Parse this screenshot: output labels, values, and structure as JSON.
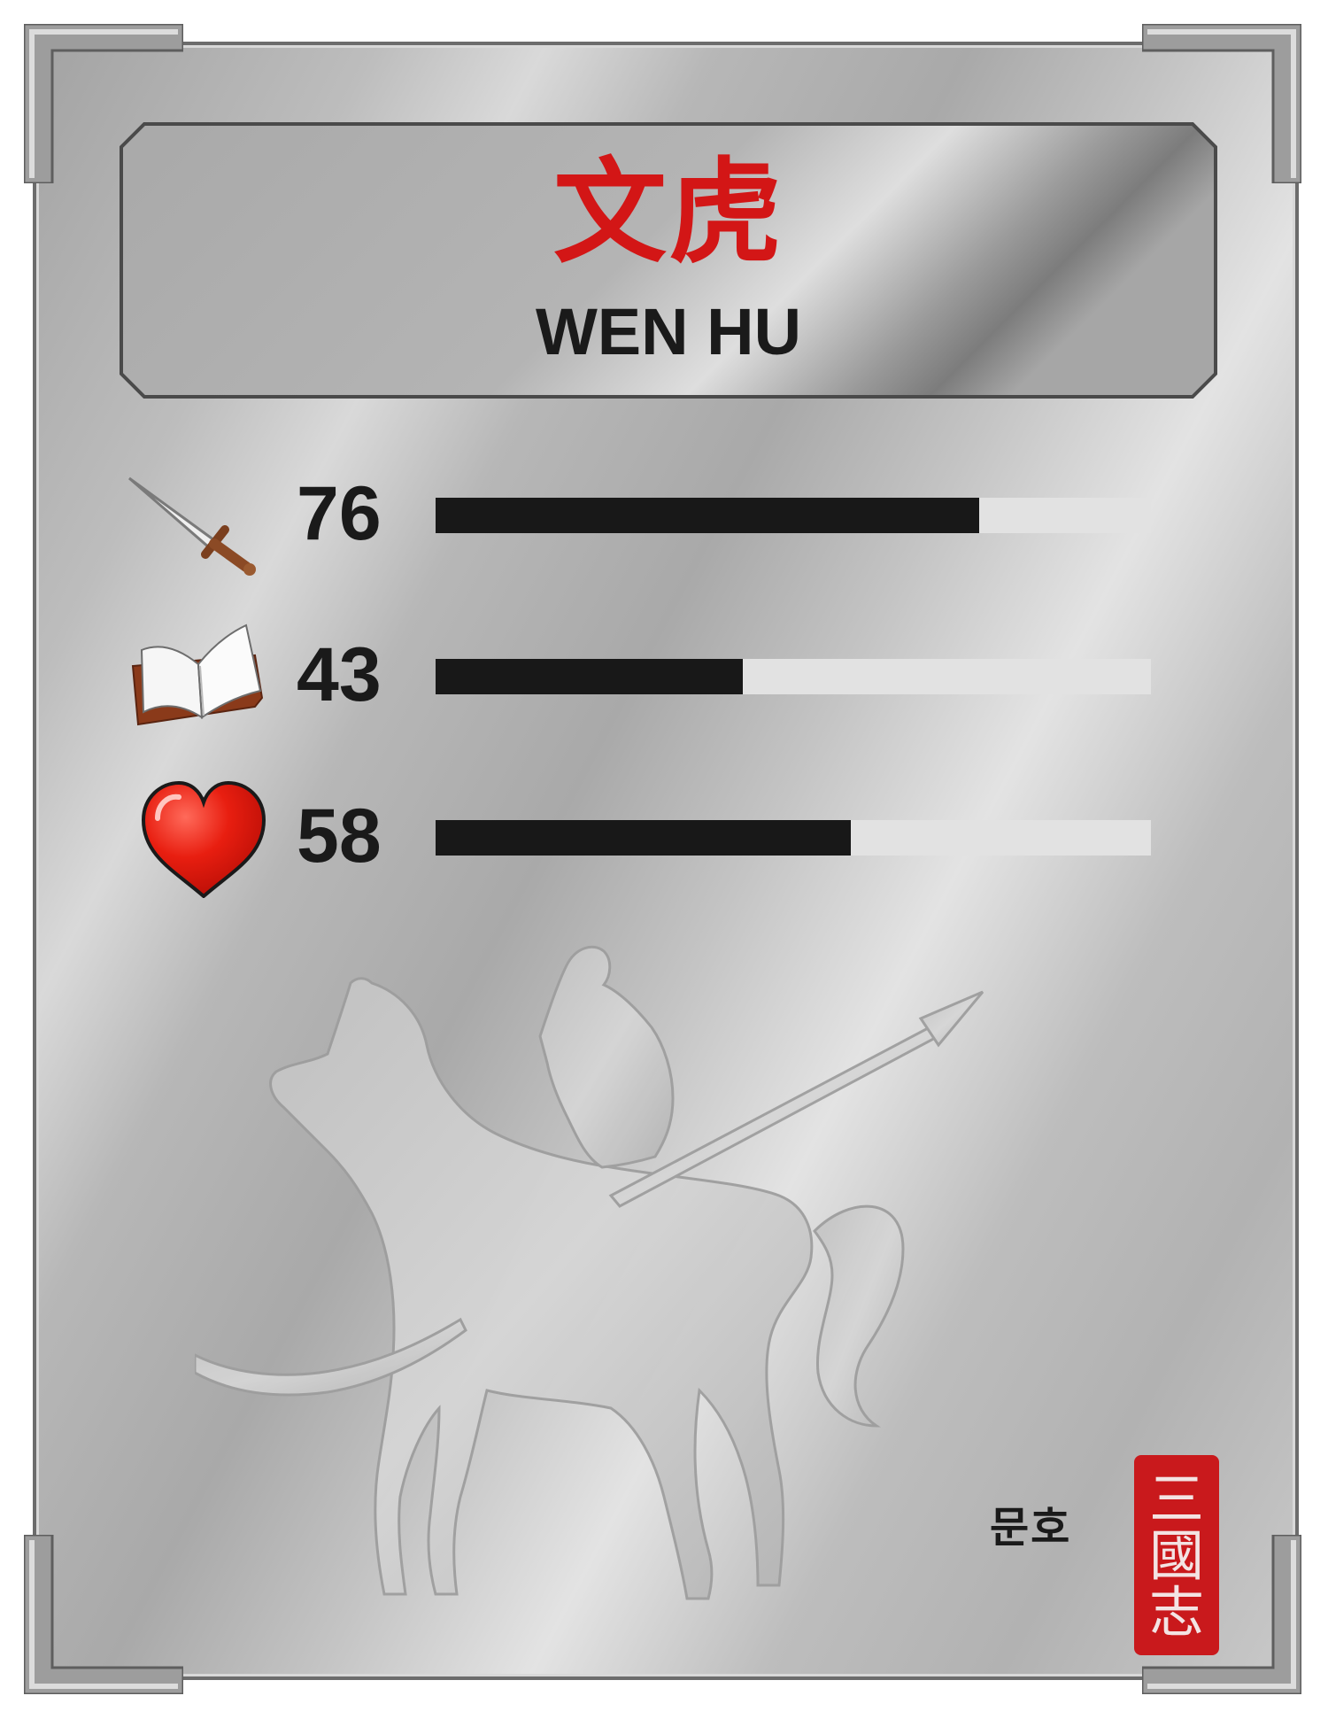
{
  "card": {
    "name_cn": "文虎",
    "name_en": "WEN HU",
    "stats": [
      {
        "icon": "sword-icon",
        "value": "76",
        "fraction": 0.76
      },
      {
        "icon": "book-icon",
        "value": "43",
        "fraction": 0.43
      },
      {
        "icon": "heart-icon",
        "value": "58",
        "fraction": 0.58
      }
    ],
    "korean_name": "문호",
    "seal_text": "三國志",
    "colors": {
      "name_cn": "#d31616",
      "bar_fill": "#181818",
      "seal": "#c9191c"
    }
  }
}
